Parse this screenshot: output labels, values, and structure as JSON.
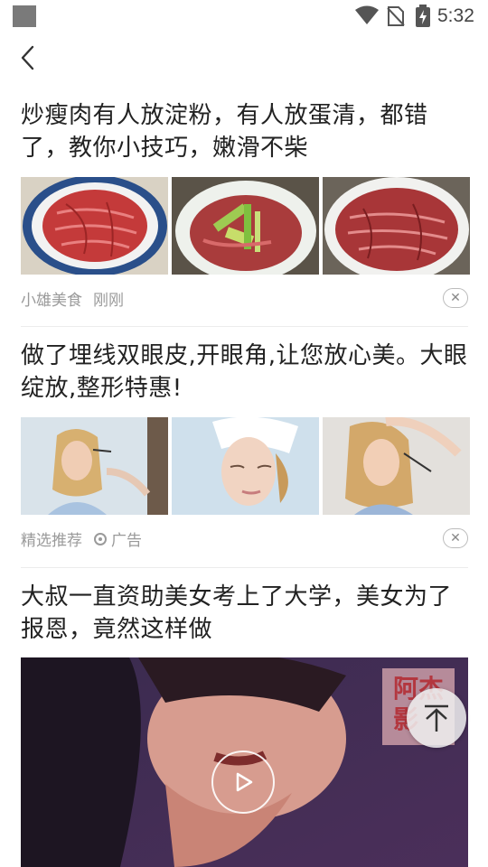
{
  "status_bar": {
    "time": "5:32"
  },
  "articles": [
    {
      "title": "炒瘦肉有人放淀粉，有人放蛋清，都错了，教你小技巧，嫩滑不柴",
      "source": "小雄美食",
      "time": "刚刚",
      "image_icons": [
        "raw-meat-plate-icon",
        "meat-celery-bowl-icon",
        "marinated-meat-bowl-icon"
      ]
    },
    {
      "title": "做了埋线双眼皮,开眼角,让您放心美。大眼绽放,整形特惠!",
      "source": "精选推荐",
      "ad_label": "广告",
      "image_icons": [
        "makeup-woman-icon",
        "towel-woman-icon",
        "eye-exam-woman-icon"
      ]
    },
    {
      "title": "大叔一直资助美女考上了大学，美女为了报恩，竟然这样做",
      "watermark": "阿杰影"
    }
  ],
  "colors": {
    "meta_text": "#9a9a9a",
    "title_text": "#222222",
    "divider": "#ececec"
  }
}
